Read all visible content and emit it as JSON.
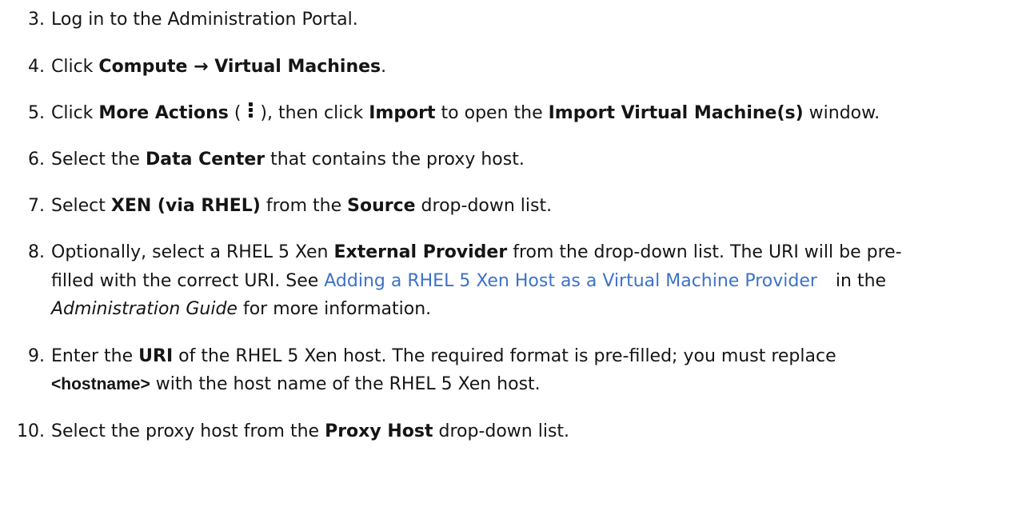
{
  "steps": [
    {
      "num": "3.",
      "parts": [
        "Log in to the Administration Portal."
      ]
    },
    {
      "num": "4.",
      "parts": [
        "Click ",
        "Compute",
        " → ",
        "Virtual Machines",
        "."
      ]
    },
    {
      "num": "5.",
      "parts": [
        "Click ",
        "More Actions",
        " ( ",
        " ), then click ",
        "Import",
        " to open the ",
        "Import Virtual Machine(s)",
        " window."
      ],
      "icon": "kebab-menu-icon"
    },
    {
      "num": "6.",
      "parts": [
        "Select the ",
        "Data Center",
        " that contains the proxy host."
      ]
    },
    {
      "num": "7.",
      "parts": [
        "Select ",
        "XEN (via RHEL)",
        " from the ",
        "Source",
        " drop-down list."
      ]
    },
    {
      "num": "8.",
      "lines": [
        [
          "Optionally, select a RHEL 5 Xen ",
          "External Provider",
          " from the drop-down list. The URI will be pre-"
        ],
        [
          "filled with the correct URI. See ",
          "Adding a RHEL 5 Xen Host as a Virtual Machine Provider",
          " in the"
        ],
        [
          "Administration Guide",
          " for more information."
        ]
      ]
    },
    {
      "num": "9.",
      "lines": [
        [
          "Enter the ",
          "URI",
          " of the RHEL 5 Xen host. The required format is pre-filled; you must replace"
        ],
        [
          "<hostname>",
          " with the host name of the RHEL 5 Xen host."
        ]
      ]
    },
    {
      "num": "10.",
      "parts": [
        "Select the proxy host from the ",
        "Proxy Host",
        " drop-down list."
      ]
    }
  ],
  "colors": {
    "text": "#151515",
    "link": "#3c72c9"
  }
}
